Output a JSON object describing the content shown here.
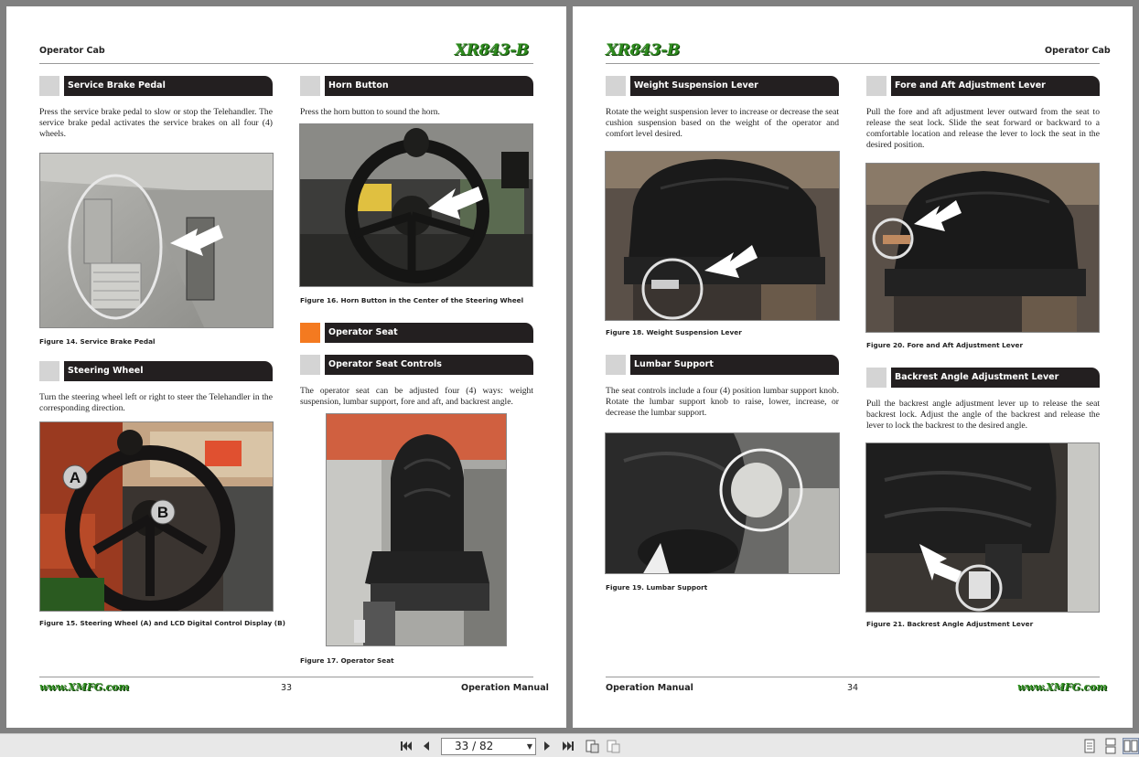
{
  "left_page": {
    "header": "Operator Cab",
    "logo": "XR843-B",
    "sections": {
      "brake": {
        "title": "Service Brake Pedal",
        "text": "Press the service brake pedal to slow or stop the Telehandler. The service brake pedal activates the service brakes on all four (4) wheels.",
        "caption": "Figure 14.  Service Brake Pedal"
      },
      "steering": {
        "title": "Steering Wheel",
        "text": "Turn the steering wheel left or right to steer the Telehandler in the corresponding direction.",
        "caption": "Figure 15.  Steering Wheel (A) and LCD Digital Control Display (B)",
        "label_a": "A",
        "label_b": "B"
      },
      "horn": {
        "title": "Horn Button",
        "text": "Press the horn button to sound the horn.",
        "caption": "Figure 16.  Horn Button in the Center of the Steering Wheel"
      },
      "seat": {
        "title": "Operator Seat"
      },
      "seat_controls": {
        "title": "Operator Seat Controls",
        "text": "The operator seat can be adjusted four (4) ways: weight suspension, lumbar support, fore and aft, and backrest angle.",
        "caption": "Figure 17.  Operator Seat"
      }
    },
    "footer": {
      "site": "www.XMFG.com",
      "page_number": "33",
      "manual": "Operation Manual"
    }
  },
  "right_page": {
    "header": "Operator Cab",
    "logo": "XR843-B",
    "sections": {
      "weight": {
        "title": "Weight Suspension Lever",
        "text": "Rotate the weight suspension lever to increase or decrease the seat cushion suspension based on the weight of the operator and comfort level desired.",
        "caption": "Figure 18.  Weight Suspension Lever"
      },
      "lumbar": {
        "title": "Lumbar Support",
        "text": "The seat controls include a four (4) position lumbar support knob.  Rotate the lumbar support knob to raise, lower, increase, or decrease the lumbar support.",
        "caption": "Figure 19.  Lumbar Support"
      },
      "fore_aft": {
        "title": "Fore and Aft Adjustment Lever",
        "text": "Pull the fore and aft adjustment lever outward from the seat to release the seat lock. Slide the seat forward or backward to a comfortable location and release the lever to lock the seat in the desired position.",
        "caption": "Figure 20.  Fore and Aft Adjustment Lever"
      },
      "backrest": {
        "title": "Backrest Angle Adjustment Lever",
        "text": "Pull the backrest angle adjustment lever up to release the seat backrest lock. Adjust the angle of the backrest and release the lever to lock the backrest to the desired angle.",
        "caption": "Figure 21.  Backrest Angle Adjustment Lever"
      }
    },
    "footer": {
      "manual": "Operation Manual",
      "page_number": "34",
      "site": "www.XMFG.com"
    }
  },
  "toolbar": {
    "page_indicator": "33 / 82",
    "icons": [
      "first-page-icon",
      "prev-page-icon",
      "next-page-icon",
      "last-page-icon",
      "fit-page-icon",
      "fit-width-icon",
      "single-page-icon",
      "continuous-icon",
      "two-page-icon"
    ]
  },
  "colors": {
    "accent_orange": "#f47a20",
    "header_bar": "#231f20",
    "logo_green": "#2e8b1e",
    "viewer_bg": "#808080"
  }
}
